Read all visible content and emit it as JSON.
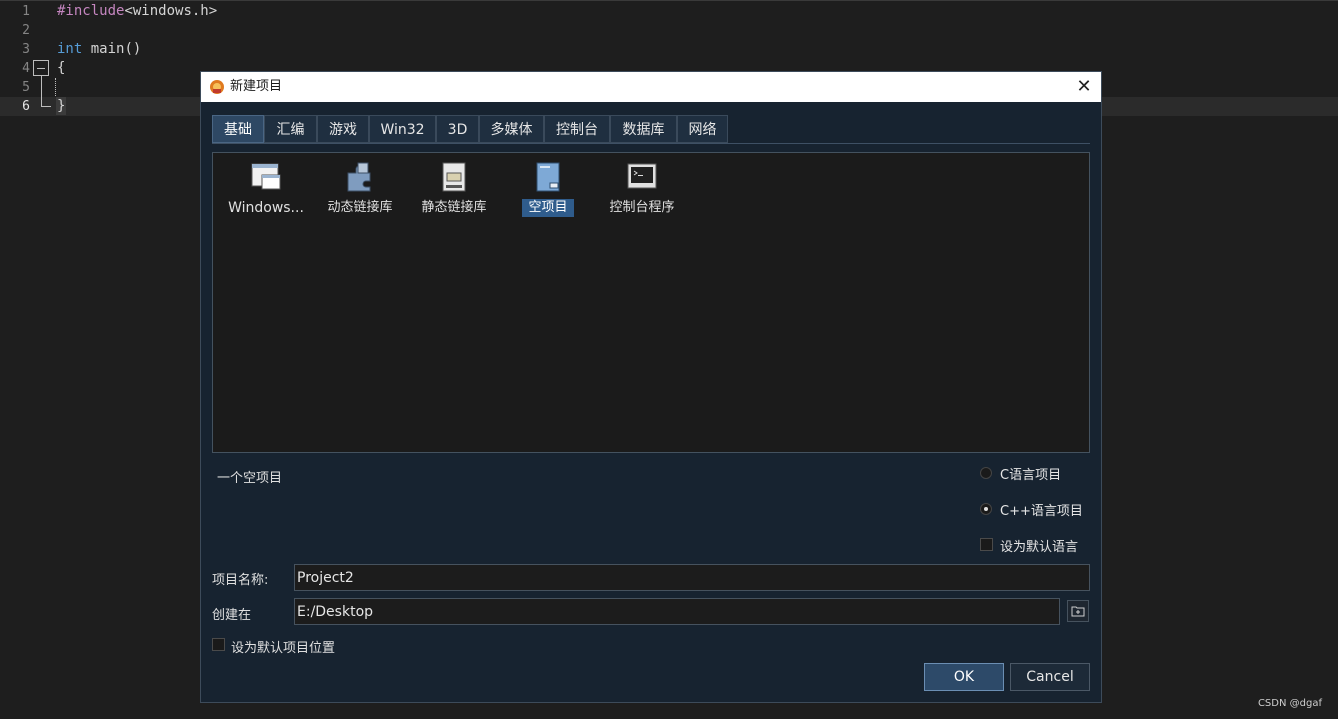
{
  "editor": {
    "lines": [
      {
        "num": "1",
        "preproc": "#include",
        "rest": "<windows.h>"
      },
      {
        "num": "2"
      },
      {
        "num": "3",
        "kw": "int",
        "rest": " main()"
      },
      {
        "num": "4",
        "rest": "{"
      },
      {
        "num": "5"
      },
      {
        "num": "6",
        "rest": "}"
      }
    ],
    "watermark": "CSDN @dgaf"
  },
  "dialog": {
    "title": "新建项目",
    "close_glyph": "✕",
    "tabs": [
      "基础",
      "汇编",
      "游戏",
      "Win32",
      "3D",
      "多媒体",
      "控制台",
      "数据库",
      "网络"
    ],
    "active_tab": "基础",
    "templates": [
      {
        "label": "Windows...",
        "icon": "windows-app-icon"
      },
      {
        "label": "动态链接库",
        "icon": "puzzle-dll-icon"
      },
      {
        "label": "静态链接库",
        "icon": "static-lib-icon"
      },
      {
        "label": "空项目",
        "icon": "empty-project-icon",
        "selected": true
      },
      {
        "label": "控制台程序",
        "icon": "console-icon"
      }
    ],
    "description": "一个空项目",
    "language_options": [
      {
        "label": "C语言项目",
        "checked": false
      },
      {
        "label": "C++语言项目",
        "checked": true
      }
    ],
    "default_language_label": "设为默认语言",
    "project_name_label": "项目名称:",
    "project_name_value": "Project2",
    "location_label": "创建在",
    "location_value": "E:/Desktop",
    "default_location_label": "设为默认项目位置",
    "ok_label": "OK",
    "cancel_label": "Cancel"
  },
  "colors": {
    "dialog_bg": "#172330",
    "selected_bg": "#2f5c8c",
    "keyword": "#569cd6",
    "preprocessor": "#c586c0"
  }
}
